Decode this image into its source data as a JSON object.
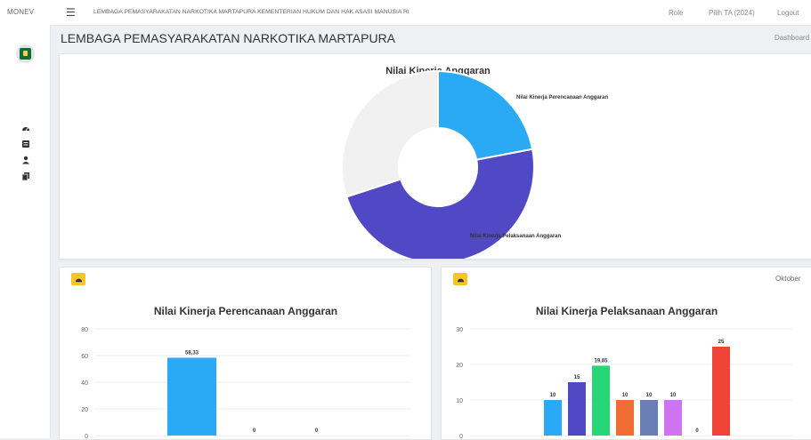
{
  "app": {
    "name": "MONEV",
    "org_full": "LEMBAGA PEMASYARAKATAN NARKOTIKA MARTAPURA KEMENTERIAN HUKUM DAN HAK ASASI MANUSIA RI"
  },
  "topnav": {
    "role": "Role",
    "year": "Pilih TA (2024)",
    "logout": "Logout"
  },
  "page": {
    "title": "LEMBAGA PEMASYARAKATAN NARKOTIKA MARTAPURA",
    "breadcrumb": "Dashboard"
  },
  "sidebar": {
    "icons": [
      "dashboard-icon",
      "document-icon",
      "user-icon",
      "copy-icon"
    ]
  },
  "donut": {
    "title": "Nilai Kinerja Anggaran",
    "slices": [
      {
        "name": "Nilai Kinerja Perencanaan Anggaran",
        "value": 22,
        "color": "#2aaaf5"
      },
      {
        "name": "Nilai Kinerja Pelaksanaan Anggaran",
        "value": 48,
        "color": "#5048c4"
      },
      {
        "name": "",
        "value": 30,
        "color": "#f1f1f1"
      }
    ]
  },
  "panel_left": {
    "badge_icon": "chart-icon"
  },
  "panel_right": {
    "badge_icon": "chart-icon",
    "month": "Oktober"
  },
  "chart_data": [
    {
      "type": "bar",
      "title": "Nilai Kinerja Perencanaan Anggaran",
      "values": [
        58.33,
        0,
        0
      ],
      "value_labels": [
        "58,33",
        "0",
        "0"
      ],
      "colors": [
        "#2aaaf5",
        "#5048c4",
        "#2ecc71"
      ],
      "yticks": [
        "0",
        "20",
        "40",
        "60",
        "80"
      ],
      "ylim": [
        0,
        80
      ]
    },
    {
      "type": "bar",
      "title": "Nilai Kinerja Pelaksanaan Anggaran",
      "values": [
        10,
        15,
        19.65,
        10,
        10,
        10,
        0,
        25
      ],
      "value_labels": [
        "10",
        "15",
        "19,65",
        "10",
        "10",
        "10",
        "0",
        "25"
      ],
      "colors": [
        "#2aaaf5",
        "#5048c4",
        "#27d676",
        "#f26d33",
        "#6a7fb8",
        "#cf74f0",
        "#9aa0aa",
        "#f04438"
      ],
      "yticks": [
        "0",
        "10",
        "20",
        "30"
      ],
      "ylim": [
        0,
        30
      ]
    }
  ]
}
